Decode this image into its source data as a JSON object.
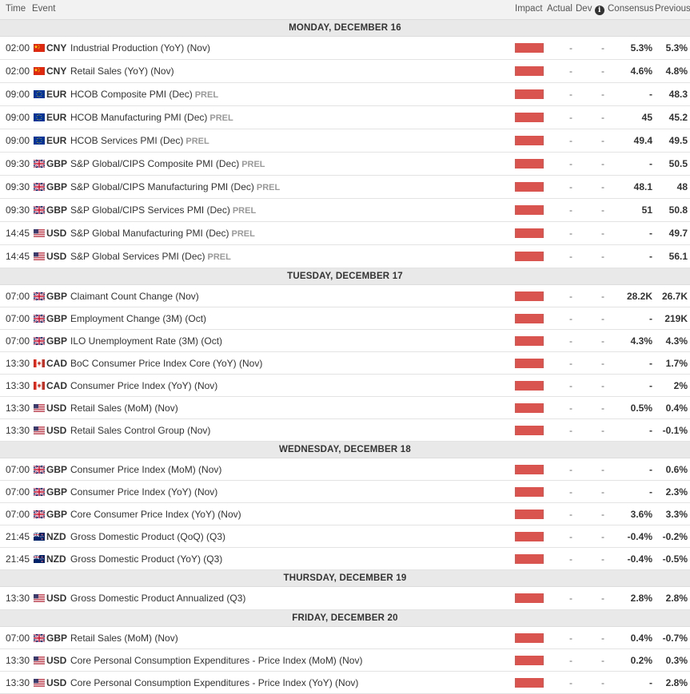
{
  "header": {
    "time": "Time",
    "event": "Event",
    "impact": "Impact",
    "actual": "Actual",
    "deviation": "Dev",
    "consensus": "Consensus",
    "previous": "Previous"
  },
  "colors": {
    "impact_high": "#d9534f",
    "header_bg": "#f2f2f2",
    "day_bg": "#e9e9e9"
  },
  "days": [
    {
      "label": "MONDAY, DECEMBER 16",
      "events": [
        {
          "time": "02:00",
          "flag": "cn-flag-icon",
          "currency": "CNY",
          "event": "Industrial Production (YoY) (Nov)",
          "prel": "",
          "impact": "high",
          "actual": "-",
          "dev": "-",
          "consensus": "5.3%",
          "previous": "5.3%"
        },
        {
          "time": "02:00",
          "flag": "cn-flag-icon",
          "currency": "CNY",
          "event": "Retail Sales (YoY) (Nov)",
          "prel": "",
          "impact": "high",
          "actual": "-",
          "dev": "-",
          "consensus": "4.6%",
          "previous": "4.8%"
        },
        {
          "time": "09:00",
          "flag": "eu-flag-icon",
          "currency": "EUR",
          "event": "HCOB Composite PMI (Dec)",
          "prel": "PREL",
          "impact": "high",
          "actual": "-",
          "dev": "-",
          "consensus": "-",
          "previous": "48.3"
        },
        {
          "time": "09:00",
          "flag": "eu-flag-icon",
          "currency": "EUR",
          "event": "HCOB Manufacturing PMI (Dec)",
          "prel": "PREL",
          "impact": "high",
          "actual": "-",
          "dev": "-",
          "consensus": "45",
          "previous": "45.2"
        },
        {
          "time": "09:00",
          "flag": "eu-flag-icon",
          "currency": "EUR",
          "event": "HCOB Services PMI (Dec)",
          "prel": "PREL",
          "impact": "high",
          "actual": "-",
          "dev": "-",
          "consensus": "49.4",
          "previous": "49.5"
        },
        {
          "time": "09:30",
          "flag": "gb-flag-icon",
          "currency": "GBP",
          "event": "S&P Global/CIPS Composite PMI (Dec)",
          "prel": "PREL",
          "impact": "high",
          "actual": "-",
          "dev": "-",
          "consensus": "-",
          "previous": "50.5"
        },
        {
          "time": "09:30",
          "flag": "gb-flag-icon",
          "currency": "GBP",
          "event": "S&P Global/CIPS Manufacturing PMI (Dec)",
          "prel": "PREL",
          "impact": "high",
          "actual": "-",
          "dev": "-",
          "consensus": "48.1",
          "previous": "48"
        },
        {
          "time": "09:30",
          "flag": "gb-flag-icon",
          "currency": "GBP",
          "event": "S&P Global/CIPS Services PMI (Dec)",
          "prel": "PREL",
          "impact": "high",
          "actual": "-",
          "dev": "-",
          "consensus": "51",
          "previous": "50.8"
        },
        {
          "time": "14:45",
          "flag": "us-flag-icon",
          "currency": "USD",
          "event": "S&P Global Manufacturing PMI (Dec)",
          "prel": "PREL",
          "impact": "high",
          "actual": "-",
          "dev": "-",
          "consensus": "-",
          "previous": "49.7"
        },
        {
          "time": "14:45",
          "flag": "us-flag-icon",
          "currency": "USD",
          "event": "S&P Global Services PMI (Dec)",
          "prel": "PREL",
          "impact": "high",
          "actual": "-",
          "dev": "-",
          "consensus": "-",
          "previous": "56.1"
        }
      ]
    },
    {
      "label": "TUESDAY, DECEMBER 17",
      "events": [
        {
          "time": "07:00",
          "flag": "gb-flag-icon",
          "currency": "GBP",
          "event": "Claimant Count Change (Nov)",
          "prel": "",
          "impact": "high",
          "actual": "-",
          "dev": "-",
          "consensus": "28.2K",
          "previous": "26.7K"
        },
        {
          "time": "07:00",
          "flag": "gb-flag-icon",
          "currency": "GBP",
          "event": "Employment Change (3M) (Oct)",
          "prel": "",
          "impact": "high",
          "actual": "-",
          "dev": "-",
          "consensus": "-",
          "previous": "219K"
        },
        {
          "time": "07:00",
          "flag": "gb-flag-icon",
          "currency": "GBP",
          "event": "ILO Unemployment Rate (3M) (Oct)",
          "prel": "",
          "impact": "high",
          "actual": "-",
          "dev": "-",
          "consensus": "4.3%",
          "previous": "4.3%"
        },
        {
          "time": "13:30",
          "flag": "ca-flag-icon",
          "currency": "CAD",
          "event": "BoC Consumer Price Index Core (YoY) (Nov)",
          "prel": "",
          "impact": "high",
          "actual": "-",
          "dev": "-",
          "consensus": "-",
          "previous": "1.7%"
        },
        {
          "time": "13:30",
          "flag": "ca-flag-icon",
          "currency": "CAD",
          "event": "Consumer Price Index (YoY) (Nov)",
          "prel": "",
          "impact": "high",
          "actual": "-",
          "dev": "-",
          "consensus": "-",
          "previous": "2%"
        },
        {
          "time": "13:30",
          "flag": "us-flag-icon",
          "currency": "USD",
          "event": "Retail Sales (MoM) (Nov)",
          "prel": "",
          "impact": "high",
          "actual": "-",
          "dev": "-",
          "consensus": "0.5%",
          "previous": "0.4%"
        },
        {
          "time": "13:30",
          "flag": "us-flag-icon",
          "currency": "USD",
          "event": "Retail Sales Control Group (Nov)",
          "prel": "",
          "impact": "high",
          "actual": "-",
          "dev": "-",
          "consensus": "-",
          "previous": "-0.1%"
        }
      ]
    },
    {
      "label": "WEDNESDAY, DECEMBER 18",
      "events": [
        {
          "time": "07:00",
          "flag": "gb-flag-icon",
          "currency": "GBP",
          "event": "Consumer Price Index (MoM) (Nov)",
          "prel": "",
          "impact": "high",
          "actual": "-",
          "dev": "-",
          "consensus": "-",
          "previous": "0.6%"
        },
        {
          "time": "07:00",
          "flag": "gb-flag-icon",
          "currency": "GBP",
          "event": "Consumer Price Index (YoY) (Nov)",
          "prel": "",
          "impact": "high",
          "actual": "-",
          "dev": "-",
          "consensus": "-",
          "previous": "2.3%"
        },
        {
          "time": "07:00",
          "flag": "gb-flag-icon",
          "currency": "GBP",
          "event": "Core Consumer Price Index (YoY) (Nov)",
          "prel": "",
          "impact": "high",
          "actual": "-",
          "dev": "-",
          "consensus": "3.6%",
          "previous": "3.3%"
        },
        {
          "time": "21:45",
          "flag": "nz-flag-icon",
          "currency": "NZD",
          "event": "Gross Domestic Product (QoQ) (Q3)",
          "prel": "",
          "impact": "high",
          "actual": "-",
          "dev": "-",
          "consensus": "-0.4%",
          "previous": "-0.2%"
        },
        {
          "time": "21:45",
          "flag": "nz-flag-icon",
          "currency": "NZD",
          "event": "Gross Domestic Product (YoY) (Q3)",
          "prel": "",
          "impact": "high",
          "actual": "-",
          "dev": "-",
          "consensus": "-0.4%",
          "previous": "-0.5%"
        }
      ]
    },
    {
      "label": "THURSDAY, DECEMBER 19",
      "events": [
        {
          "time": "13:30",
          "flag": "us-flag-icon",
          "currency": "USD",
          "event": "Gross Domestic Product Annualized (Q3)",
          "prel": "",
          "impact": "high",
          "actual": "-",
          "dev": "-",
          "consensus": "2.8%",
          "previous": "2.8%"
        }
      ]
    },
    {
      "label": "FRIDAY, DECEMBER 20",
      "events": [
        {
          "time": "07:00",
          "flag": "gb-flag-icon",
          "currency": "GBP",
          "event": "Retail Sales (MoM) (Nov)",
          "prel": "",
          "impact": "high",
          "actual": "-",
          "dev": "-",
          "consensus": "0.4%",
          "previous": "-0.7%"
        },
        {
          "time": "13:30",
          "flag": "us-flag-icon",
          "currency": "USD",
          "event": "Core Personal Consumption Expenditures - Price Index (MoM) (Nov)",
          "prel": "",
          "impact": "high",
          "actual": "-",
          "dev": "-",
          "consensus": "0.2%",
          "previous": "0.3%"
        },
        {
          "time": "13:30",
          "flag": "us-flag-icon",
          "currency": "USD",
          "event": "Core Personal Consumption Expenditures - Price Index (YoY) (Nov)",
          "prel": "",
          "impact": "high",
          "actual": "-",
          "dev": "-",
          "consensus": "-",
          "previous": "2.8%"
        }
      ]
    }
  ]
}
